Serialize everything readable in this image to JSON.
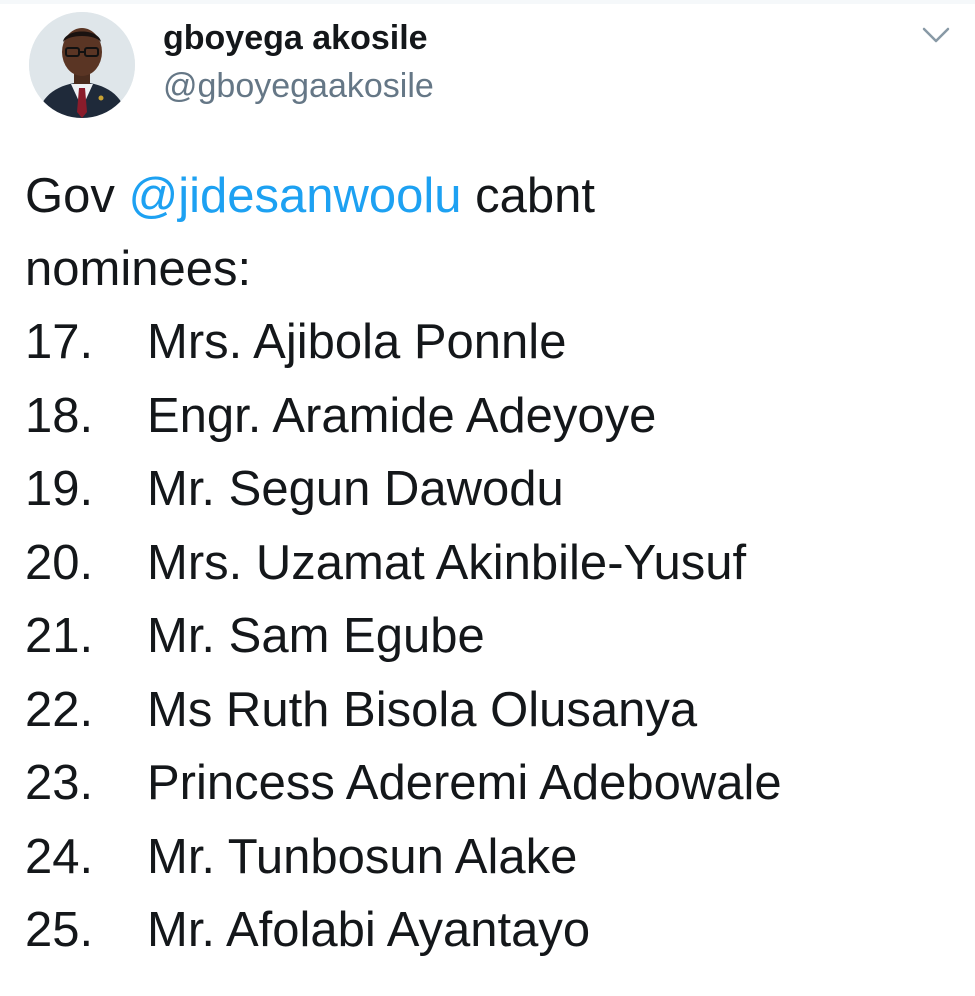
{
  "tweet": {
    "author": {
      "display_name": "gboyega akosile",
      "handle": "@gboyegaakosile"
    },
    "menu_icon": "chevron-down-icon",
    "text_prefix": "Gov ",
    "mention": "@jidesanwoolu",
    "text_suffix": " cabnt",
    "line2": "nominees:",
    "nominees": [
      {
        "num": "17.",
        "name": "Mrs. Ajibola Ponnle"
      },
      {
        "num": "18.",
        "name": "Engr. Aramide Adeyoye"
      },
      {
        "num": "19.",
        "name": "Mr. Segun Dawodu"
      },
      {
        "num": "20.",
        "name": "Mrs. Uzamat Akinbile-Yusuf"
      },
      {
        "num": "21.",
        "name": "Mr. Sam Egube"
      },
      {
        "num": "22.",
        "name": "Ms Ruth Bisola Olusanya"
      },
      {
        "num": "23.",
        "name": "Princess Aderemi Adebowale"
      },
      {
        "num": "24.",
        "name": "Mr. Tunbosun Alake"
      },
      {
        "num": "25.",
        "name": "Mr. Afolabi Ayantayo"
      }
    ]
  },
  "colors": {
    "text": "#14171a",
    "secondary": "#657786",
    "link": "#1da1f2"
  }
}
